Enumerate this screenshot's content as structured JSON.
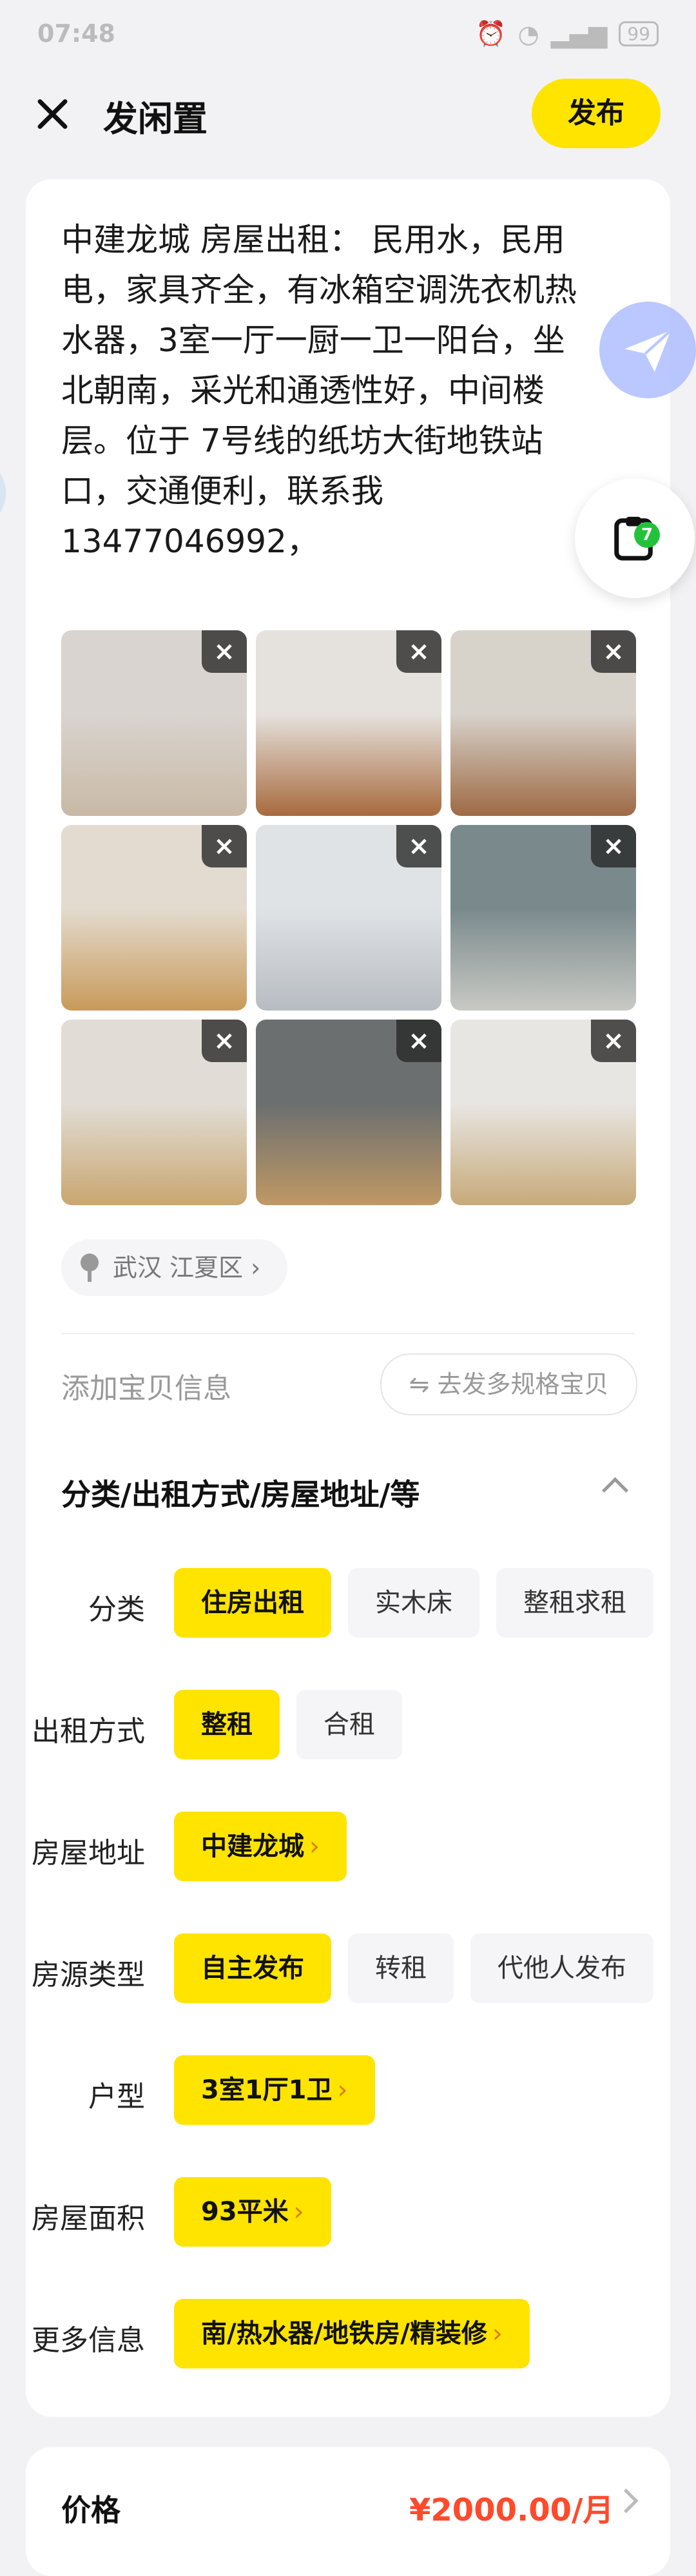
{
  "status_bar": {
    "time": "07:48",
    "battery": "99"
  },
  "header": {
    "title": "发闲置",
    "publish_label": "发布"
  },
  "description": "中建龙城 房屋出租： 民用水，民用\n电，家具齐全，有冰箱空调洗衣机热\n水器，3室一厅一厨一卫一阳台，坐\n北朝南，采光和通透性好，中间楼\n层。位于 7号线的纸坊大街地铁站\n口，交通便利，联系我\n13477046992，",
  "floating": {
    "clipboard_badge": "7"
  },
  "photos": [
    {
      "colors": [
        "#d9d4cf",
        "#c8b9a6"
      ]
    },
    {
      "colors": [
        "#e5e2dd",
        "#a86a3e"
      ]
    },
    {
      "colors": [
        "#d7d2ca",
        "#9e6a44"
      ]
    },
    {
      "colors": [
        "#e3dbcf",
        "#c89a5a"
      ]
    },
    {
      "colors": [
        "#dfe3e6",
        "#b7bcc2"
      ]
    },
    {
      "colors": [
        "#7a8a8c",
        "#c8c9c4"
      ]
    },
    {
      "colors": [
        "#e1ddd6",
        "#c9a670"
      ]
    },
    {
      "colors": [
        "#6b6f70",
        "#c09864"
      ]
    },
    {
      "colors": [
        "#e8e6e2",
        "#c7aa7a"
      ]
    }
  ],
  "delete_icon": "×",
  "location": "武汉 江夏区 ›",
  "add_info": {
    "label": "添加宝贝信息",
    "multi_spec_button": "⇋ 去发多规格宝贝"
  },
  "section": {
    "title": "分类/出租方式/房屋地址/等"
  },
  "rows": [
    {
      "label": "分类",
      "options": [
        {
          "text": "住房出租",
          "selected": true
        },
        {
          "text": "实木床"
        },
        {
          "text": "整租求租"
        }
      ]
    },
    {
      "label": "出租方式",
      "options": [
        {
          "text": "整租",
          "selected": true
        },
        {
          "text": "合租"
        }
      ]
    },
    {
      "label": "房屋地址",
      "options": [
        {
          "text": "中建龙城",
          "selected": true,
          "arrow": "›"
        }
      ]
    },
    {
      "label": "房源类型",
      "options": [
        {
          "text": "自主发布",
          "selected": true
        },
        {
          "text": "转租"
        },
        {
          "text": "代他人发布"
        }
      ]
    },
    {
      "label": "户型",
      "options": [
        {
          "text": "3室1厅1卫",
          "selected": true,
          "arrow": "›"
        }
      ]
    },
    {
      "label": "房屋面积",
      "options": [
        {
          "text": "93平米",
          "selected": true,
          "arrow": "›"
        }
      ]
    },
    {
      "label": "更多信息",
      "options": [
        {
          "text": "南/热水器/地铁房/精装修",
          "selected": true,
          "arrow": "›"
        }
      ]
    }
  ],
  "price": {
    "label": "价格",
    "value": "¥2000.00/月"
  },
  "colors": {
    "accent": "#ffe400",
    "price": "#ff4a2b",
    "background": "#f2f2f4"
  }
}
